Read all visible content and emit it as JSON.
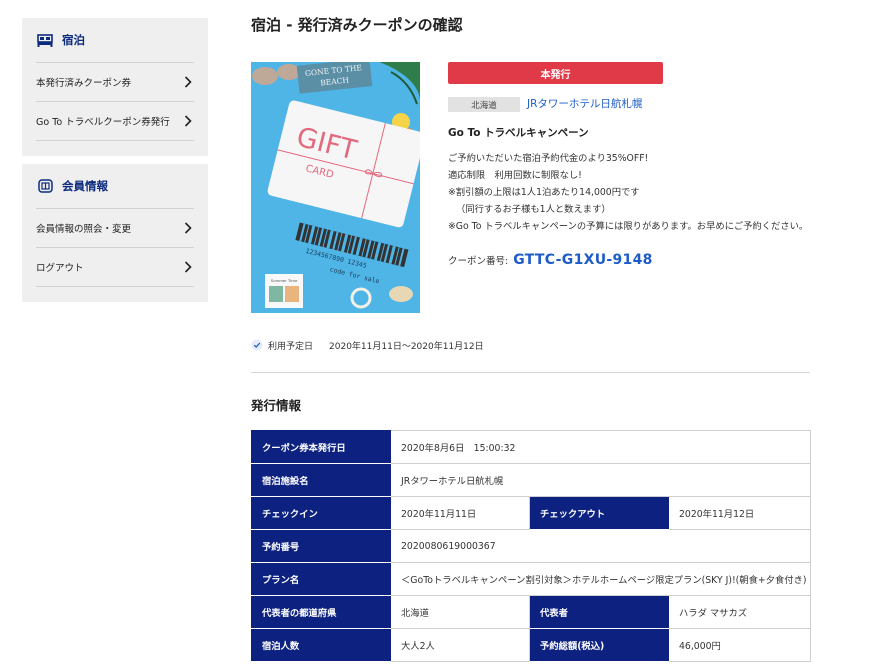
{
  "sidebar": {
    "lodging_section": {
      "title": "宿泊",
      "icon": "bed-icon",
      "items": [
        {
          "label": "本発行済みクーポン券"
        },
        {
          "label": "Go To トラベルクーポン券発行"
        }
      ]
    },
    "member_section": {
      "title": "会員情報",
      "icon": "member-card-icon",
      "items": [
        {
          "label": "会員情報の照会・変更"
        },
        {
          "label": "ログアウト"
        }
      ]
    }
  },
  "page": {
    "title": "宿泊 - 発行済みクーポンの確認"
  },
  "image": {
    "sign_line1": "GONE TO THE",
    "sign_line2": "BEACH",
    "gift_text": "GIFT",
    "card_text": "CARD",
    "barcode_number": "1234567890 12345",
    "barcode_caption": "code for sale",
    "postcard_text": "Summer Time"
  },
  "coupon": {
    "issue_button": "本発行",
    "prefecture": "北海道",
    "hotel_name": "JRタワーホテル日航札幌",
    "campaign": "Go To トラベルキャンペーン",
    "description": [
      "ご予約いただいた宿泊予約代金のより35%OFF!",
      "適応制限　利用回数に制限なし!",
      "※割引額の上限は1人1泊あたり14,000円です",
      "（同行するお子様も1人と数えます）",
      "※Go To トラベルキャンペーンの予算には限りがあります。お早めにご予約ください。"
    ],
    "number_label": "クーポン番号:",
    "number": "GTTC-G1XU-9148"
  },
  "usage": {
    "label": "利用予定日",
    "value": "2020年11月11日～2020年11月12日"
  },
  "issue_info": {
    "title": "発行情報",
    "rows": [
      {
        "label": "クーポン券本発行日",
        "value": "2020年8月6日　15:00:32"
      },
      {
        "label": "宿泊施設名",
        "value": "JRタワーホテル日航札幌"
      },
      {
        "label": "チェックイン",
        "value": "2020年11月11日",
        "label2": "チェックアウト",
        "value2": "2020年11月12日"
      },
      {
        "label": "予約番号",
        "value": "2020080619000367"
      },
      {
        "label": "プラン名",
        "value": "＜GoToトラベルキャンペーン割引対象＞ホテルホームページ限定プラン(SKY J)!(朝食+夕食付き)"
      },
      {
        "label": "代表者の都道府県",
        "value": "北海道",
        "label2": "代表者",
        "value2": "ハラダ マサカズ"
      },
      {
        "label": "宿泊人数",
        "value": "大人2人",
        "label2": "予約総額(税込)",
        "value2": "46,000円"
      }
    ]
  },
  "colors": {
    "navy": "#0d2280",
    "accent_red": "#e03a49",
    "link_blue": "#1d5cc8",
    "sidebar_bg": "#efefef",
    "image_bg": "#4fb4e6"
  }
}
